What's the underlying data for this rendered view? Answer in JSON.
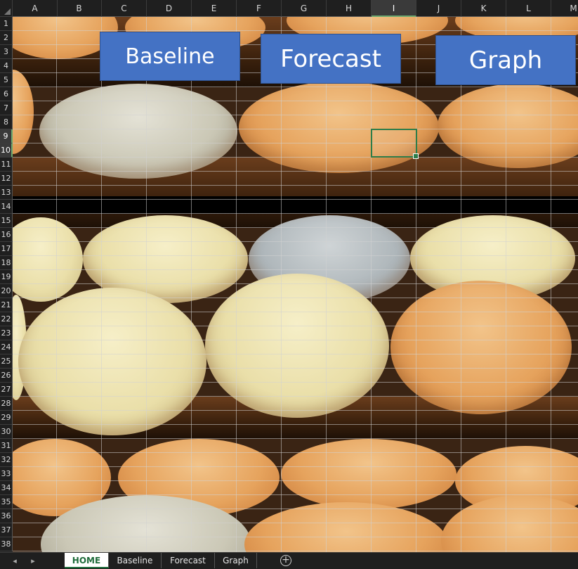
{
  "columns": [
    "A",
    "B",
    "C",
    "D",
    "E",
    "F",
    "G",
    "H",
    "I",
    "J",
    "K",
    "L",
    "M"
  ],
  "active_column": "I",
  "rows": [
    "1",
    "2",
    "3",
    "4",
    "5",
    "6",
    "7",
    "8",
    "9",
    "10",
    "11",
    "12",
    "13",
    "14",
    "15",
    "16",
    "17",
    "18",
    "19",
    "20",
    "21",
    "22",
    "23",
    "24",
    "25",
    "26",
    "27",
    "28",
    "29",
    "30",
    "31",
    "32",
    "33",
    "34",
    "35",
    "36",
    "37",
    "38"
  ],
  "active_rows": [
    "9",
    "10"
  ],
  "buttons": {
    "baseline": "Baseline",
    "forecast": "Forecast",
    "graph": "Graph"
  },
  "sheet_tabs": [
    {
      "label": "HOME",
      "active": true
    },
    {
      "label": "Baseline",
      "active": false
    },
    {
      "label": "Forecast",
      "active": false
    },
    {
      "label": "Graph",
      "active": false
    }
  ],
  "tab_nav": {
    "prev": "◂",
    "next": "▸"
  },
  "add_sheet": "+",
  "colors": {
    "button_fill": "#4472c4",
    "selection": "#2e7d4a",
    "active_tab_text": "#1e6b3a"
  }
}
